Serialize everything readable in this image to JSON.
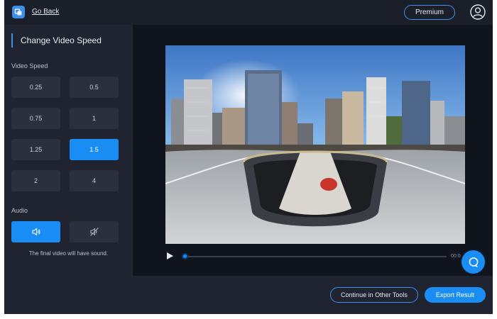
{
  "header": {
    "logo_icon": "app-logo-icon",
    "go_back_label": "Go Back",
    "premium_label": "Premium",
    "user_icon": "user-icon"
  },
  "sidebar": {
    "title": "Change Video Speed",
    "speed_label": "Video Speed",
    "speeds": [
      "0.25",
      "0.5",
      "0.75",
      "1",
      "1.25",
      "1.5",
      "2",
      "4"
    ],
    "selected_speed": "1.5",
    "audio_label": "Audio",
    "audio_on_icon": "speaker-icon",
    "audio_off_icon": "speaker-muted-icon",
    "audio_enabled": true,
    "audio_note": "The final video will have sound."
  },
  "player": {
    "play_icon": "play-icon",
    "progress": 0.01,
    "timecode": "00:0"
  },
  "chat": {
    "icon": "chat-bubble-icon"
  },
  "footer": {
    "continue_label": "Continue in Other Tools",
    "export_label": "Export Result"
  },
  "colors": {
    "accent": "#1a8df5",
    "background": "#1a1f2a",
    "panel": "#1f2430",
    "button": "#2a303d"
  }
}
